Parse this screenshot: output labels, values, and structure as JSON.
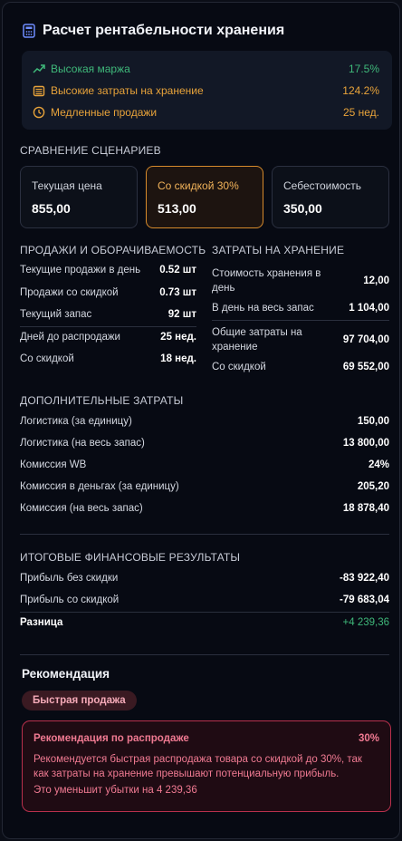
{
  "header": {
    "title": "Расчет рентабельности хранения"
  },
  "alerts": [
    {
      "label": "Высокая маржа",
      "value": "17.5%",
      "color": "#3fb87a",
      "icon": "trending-up-icon"
    },
    {
      "label": "Высокие затраты на хранение",
      "value": "124.2%",
      "color": "#e8a33a",
      "icon": "warehouse-icon"
    },
    {
      "label": "Медленные продажи",
      "value": "25 нед.",
      "color": "#e8a33a",
      "icon": "clock-icon"
    }
  ],
  "scenarios": {
    "title": "СРАВНЕНИЕ СЦЕНАРИЕВ",
    "items": [
      {
        "label": "Текущая цена",
        "value": "855,00"
      },
      {
        "label": "Со скидкой 30%",
        "value": "513,00"
      },
      {
        "label": "Себестоимость",
        "value": "350,00"
      }
    ]
  },
  "sales": {
    "title": "ПРОДАЖИ И ОБОРАЧИВАЕМОСТЬ",
    "rows": [
      {
        "label": "Текущие продажи в день",
        "value": "0.52 шт"
      },
      {
        "label": "Продажи со скидкой",
        "value": "0.73 шт"
      },
      {
        "label": "Текущий запас",
        "value": "92 шт"
      },
      {
        "label": "Дней до распродажи",
        "value": "25 нед."
      },
      {
        "label": "Со скидкой",
        "value": "18 нед."
      }
    ]
  },
  "storage": {
    "title": "ЗАТРАТЫ НА ХРАНЕНИЕ",
    "rows": [
      {
        "label": "Стоимость хранения в день",
        "value": "12,00"
      },
      {
        "label": "В день на весь запас",
        "value": "1 104,00"
      },
      {
        "label": "Общие затраты на хранение",
        "value": "97 704,00"
      },
      {
        "label": "Со скидкой",
        "value": "69 552,00"
      }
    ]
  },
  "extra": {
    "title": "ДОПОЛНИТЕЛЬНЫЕ ЗАТРАТЫ",
    "rows": [
      {
        "label": "Логистика (за единицу)",
        "value": "150,00"
      },
      {
        "label": "Логистика (на весь запас)",
        "value": "13 800,00"
      },
      {
        "label": "Комиссия WB",
        "value": "24%"
      },
      {
        "label": "Комиссия в деньгах (за единицу)",
        "value": "205,20"
      },
      {
        "label": "Комиссия (на весь запас)",
        "value": "18 878,40"
      }
    ]
  },
  "results": {
    "title": "ИТОГОВЫЕ ФИНАНСОВЫЕ РЕЗУЛЬТАТЫ",
    "rows": [
      {
        "label": "Прибыль без скидки",
        "value": "-83 922,40"
      },
      {
        "label": "Прибыль со скидкой",
        "value": "-79 683,04"
      },
      {
        "label": "Разница",
        "value": "+4 239,36"
      }
    ]
  },
  "recommendation": {
    "title": "Рекомендация",
    "badge": "Быстрая продажа",
    "box_title": "Рекомендация по распродаже",
    "box_percent": "30%",
    "box_text": "Рекомендуется быстрая распродажа товара со скидкой до 30%, так как затраты на хранение превышают потенциальную прибыль.",
    "box_footer": "Это уменьшит убытки на 4 239,36"
  },
  "colors": {
    "accent_green": "#3fb87a",
    "accent_orange": "#e8a33a",
    "accent_red": "#f07a92"
  }
}
